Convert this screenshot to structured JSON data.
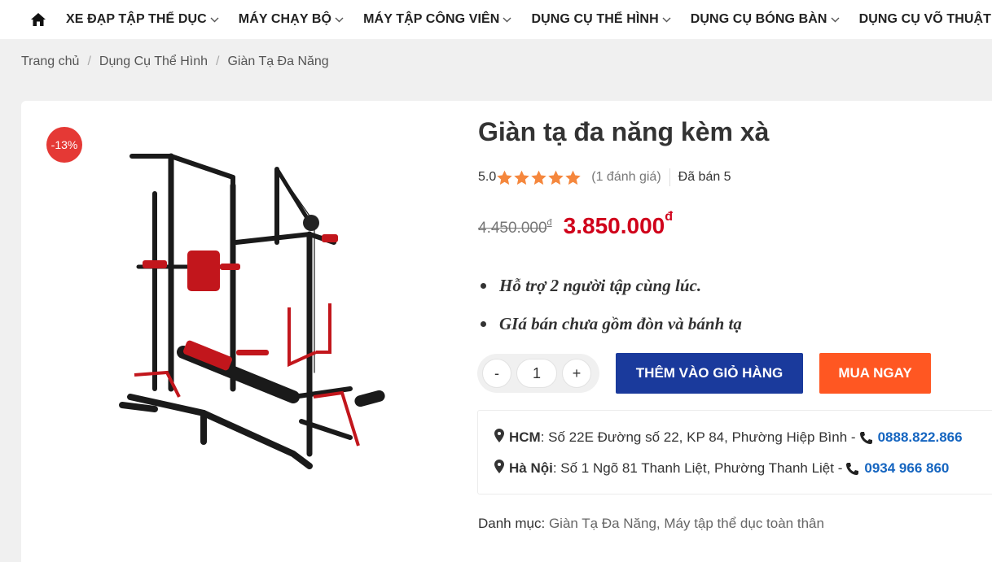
{
  "nav": {
    "home_icon": "home-icon",
    "items": [
      {
        "label": "XE ĐẠP TẬP THỂ DỤC"
      },
      {
        "label": "MÁY CHẠY BỘ"
      },
      {
        "label": "MÁY TẬP CÔNG VIÊN"
      },
      {
        "label": "DỤNG CỤ THỂ HÌNH"
      },
      {
        "label": "DỤNG CỤ BÓNG BÀN"
      },
      {
        "label": "DỤNG CỤ VÕ THUẬT"
      }
    ]
  },
  "breadcrumb": {
    "items": [
      "Trang chủ",
      "Dụng Cụ Thể Hình",
      "Giàn Tạ Đa Năng"
    ],
    "separator": "/"
  },
  "product": {
    "discount": "-13%",
    "title": "Giàn tạ đa năng kèm xà",
    "rating": "5.0",
    "review_count": "(1 đánh giá)",
    "sold": "Đã bán 5",
    "old_price": "4.450.000",
    "new_price": "3.850.000",
    "currency": "đ",
    "features": [
      "Hỗ trợ 2 người tập cùng lúc.",
      "GIá bán chưa gồm đòn và bánh tạ"
    ],
    "quantity": "1",
    "minus": "-",
    "plus": "+",
    "add_to_cart": "THÊM VÀO GIỎ HÀNG",
    "buy_now": "MUA NGAY",
    "category_label": "Danh mục:",
    "categories": "Giàn Tạ Đa Năng, Máy tập thể dục toàn thân"
  },
  "stores": [
    {
      "city": "HCM",
      "address": ": Số 22E Đường số 22, KP 84, Phường Hiệp Bình -",
      "phone": "0888.822.866"
    },
    {
      "city": "Hà Nội",
      "address": ": Số 1 Ngõ 81 Thanh Liệt, Phường Thanh Liệt -",
      "phone": "0934 966 860"
    }
  ],
  "colors": {
    "accent_blue": "#1a3a9c",
    "buy_orange": "#ff5722",
    "price_red": "#d0021b",
    "star": "#f5873d",
    "phone_blue": "#1565c0"
  }
}
